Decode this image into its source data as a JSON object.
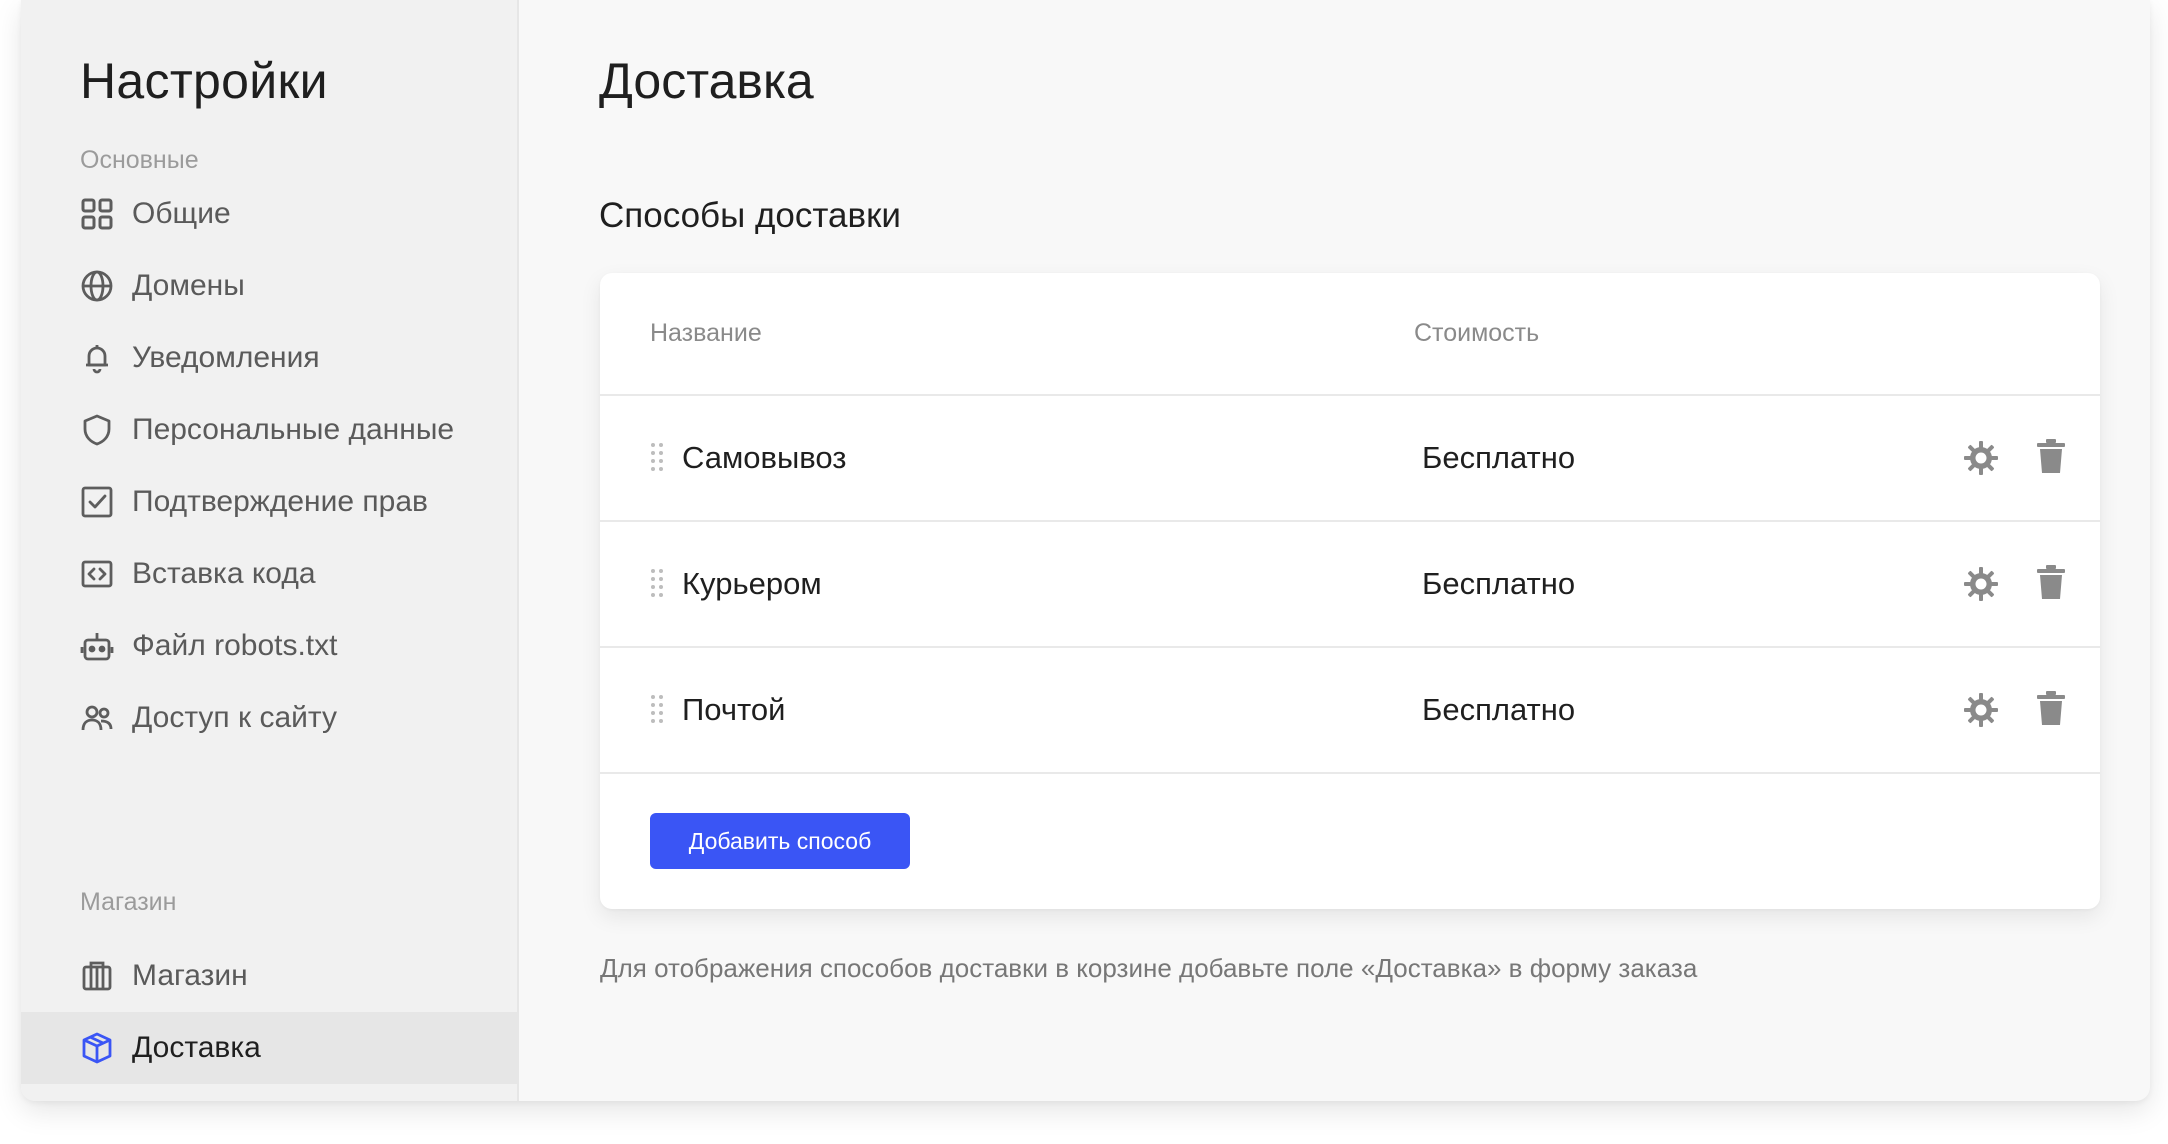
{
  "sidebar": {
    "title": "Настройки",
    "sections": [
      {
        "label": "Основные",
        "items": [
          {
            "label": "Общие",
            "icon": "grid-icon"
          },
          {
            "label": "Домены",
            "icon": "globe-icon"
          },
          {
            "label": "Уведомления",
            "icon": "bell-icon"
          },
          {
            "label": "Персональные данные",
            "icon": "shield-icon"
          },
          {
            "label": "Подтверждение прав",
            "icon": "checkbox-icon"
          },
          {
            "label": "Вставка кода",
            "icon": "code-icon"
          },
          {
            "label": "Файл robots.txt",
            "icon": "robot-icon"
          },
          {
            "label": "Доступ к сайту",
            "icon": "users-icon"
          }
        ]
      },
      {
        "label": "Магазин",
        "items": [
          {
            "label": "Магазин",
            "icon": "shop-icon"
          },
          {
            "label": "Доставка",
            "icon": "box-icon",
            "active": true
          }
        ]
      }
    ]
  },
  "main": {
    "title": "Доставка",
    "section_title": "Способы доставки",
    "table": {
      "columns": [
        "Название",
        "Стоимость"
      ],
      "rows": [
        {
          "name": "Самовывоз",
          "cost": "Бесплатно"
        },
        {
          "name": "Курьером",
          "cost": "Бесплатно"
        },
        {
          "name": "Почтой",
          "cost": "Бесплатно"
        }
      ]
    },
    "add_button": "Добавить способ",
    "hint": "Для отображения способов доставки в корзине добавьте поле «Доставка» в форму заказа"
  },
  "colors": {
    "accent": "#3a55f5",
    "sidebar_bg": "#f1f1f1",
    "main_bg": "#f8f8f8",
    "active_item_bg": "#e6e6e6",
    "icon_gray": "#8a8a8a"
  }
}
